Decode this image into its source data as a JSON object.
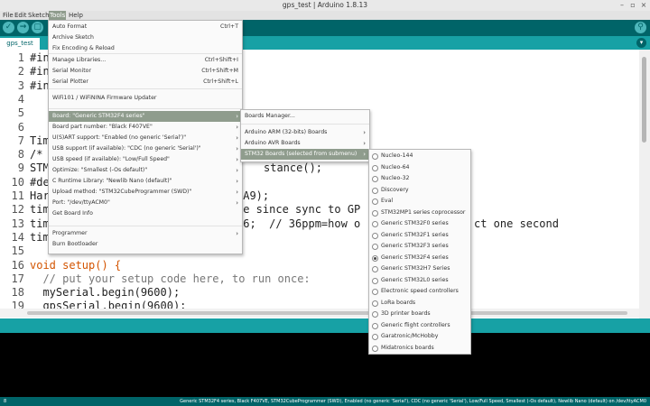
{
  "window": {
    "title": "gps_test | Arduino 1.8.13"
  },
  "menubar": [
    "File",
    "Edit",
    "Sketch",
    "Tools",
    "Help"
  ],
  "tab": {
    "label": "gps_test"
  },
  "editor": {
    "lines": [
      {
        "n": "1",
        "t": "#in"
      },
      {
        "n": "2",
        "t": "#in"
      },
      {
        "n": "3",
        "t": "#in"
      },
      {
        "n": "4",
        "t": ""
      },
      {
        "n": "5",
        "t": ""
      },
      {
        "n": "6",
        "t": ""
      },
      {
        "n": "7",
        "t": "Tim"
      },
      {
        "n": "8",
        "t": "/*"
      },
      {
        "n": "9",
        "t": "STM"
      },
      {
        "n": "10",
        "t": "#de"
      },
      {
        "n": "11",
        "t": "Har"
      },
      {
        "n": "12",
        "t": "tim"
      },
      {
        "n": "13",
        "t": "tim"
      },
      {
        "n": "14",
        "t": "tim"
      },
      {
        "n": "15",
        "t": ""
      },
      {
        "n": "16",
        "t": "void setup() {"
      },
      {
        "n": "17",
        "t": "  // put your setup code here, to run once:"
      },
      {
        "n": "18",
        "t": "  mySerial.begin(9600);"
      },
      {
        "n": "19",
        "t": "  gpsSerial.begin(9600);"
      }
    ],
    "fragments": {
      "l9": "stance();",
      "l11": "PA9);",
      "l12": "me since sync to GP",
      "l13": "36;  // 36ppm=how o",
      "l13b": "ct one second"
    }
  },
  "tools_menu": [
    {
      "label": "Auto Format",
      "shortcut": "Ctrl+T"
    },
    {
      "label": "Archive Sketch",
      "shortcut": ""
    },
    {
      "label": "Fix Encoding & Reload",
      "shortcut": ""
    },
    {
      "label": "Manage Libraries...",
      "shortcut": "Ctrl+Shift+I"
    },
    {
      "label": "Serial Monitor",
      "shortcut": "Ctrl+Shift+M"
    },
    {
      "label": "Serial Plotter",
      "shortcut": "Ctrl+Shift+L"
    },
    {
      "label": "WiFi101 / WiFiNINA Firmware Updater",
      "shortcut": ""
    },
    {
      "label": "Board: \"Generic STM32F4 series\"",
      "shortcut": ""
    },
    {
      "label": "Board part number: \"Black F407VE\"",
      "shortcut": ""
    },
    {
      "label": "U(S)ART support: \"Enabled (no generic 'Serial')\"",
      "shortcut": ""
    },
    {
      "label": "USB support (if available): \"CDC (no generic 'Serial')\"",
      "shortcut": ""
    },
    {
      "label": "USB speed (if available): \"Low/Full Speed\"",
      "shortcut": ""
    },
    {
      "label": "Optimize: \"Smallest (-Os default)\"",
      "shortcut": ""
    },
    {
      "label": "C Runtime Library: \"Newlib Nano (default)\"",
      "shortcut": ""
    },
    {
      "label": "Upload method: \"STM32CubeProgrammer (SWD)\"",
      "shortcut": ""
    },
    {
      "label": "Port: \"/dev/ttyACM0\"",
      "shortcut": ""
    },
    {
      "label": "Get Board Info",
      "shortcut": ""
    },
    {
      "label": "Programmer",
      "shortcut": ""
    },
    {
      "label": "Burn Bootloader",
      "shortcut": ""
    }
  ],
  "boards_menu": [
    {
      "label": "Boards Manager..."
    },
    {
      "label": "Arduino ARM (32-bits) Boards"
    },
    {
      "label": "Arduino AVR Boards"
    },
    {
      "label": "STM32 Boards (selected from submenu)"
    }
  ],
  "stm32_menu": [
    "Nucleo-144",
    "Nucleo-64",
    "Nucleo-32",
    "Discovery",
    "Eval",
    "STM32MP1 series coprocessor",
    "Generic STM32F0 series",
    "Generic STM32F1 series",
    "Generic STM32F3 series",
    "Generic STM32F4 series",
    "Generic STM32H7 Series",
    "Generic STM32L0 series",
    "Electronic speed controllers",
    "LoRa boards",
    "3D printer boards",
    "Generic flight controllers",
    "Garatronic/McHobby",
    "Midatronics boards"
  ],
  "stm32_selected": "Generic STM32F4 series",
  "status": {
    "line": "8",
    "board_info": "Generic STM32F4 series, Black F407VE, STM32CubeProgrammer (SWD), Enabled (no generic 'Serial'), CDC (no generic 'Serial'), Low/Full Speed, Smallest (-Os default), Newlib Nano (default) on /dev/ttyACM0"
  },
  "colors": {
    "teal_dark": "#006468",
    "teal_light": "#17a1a5",
    "highlight": "#8f9c8d"
  }
}
